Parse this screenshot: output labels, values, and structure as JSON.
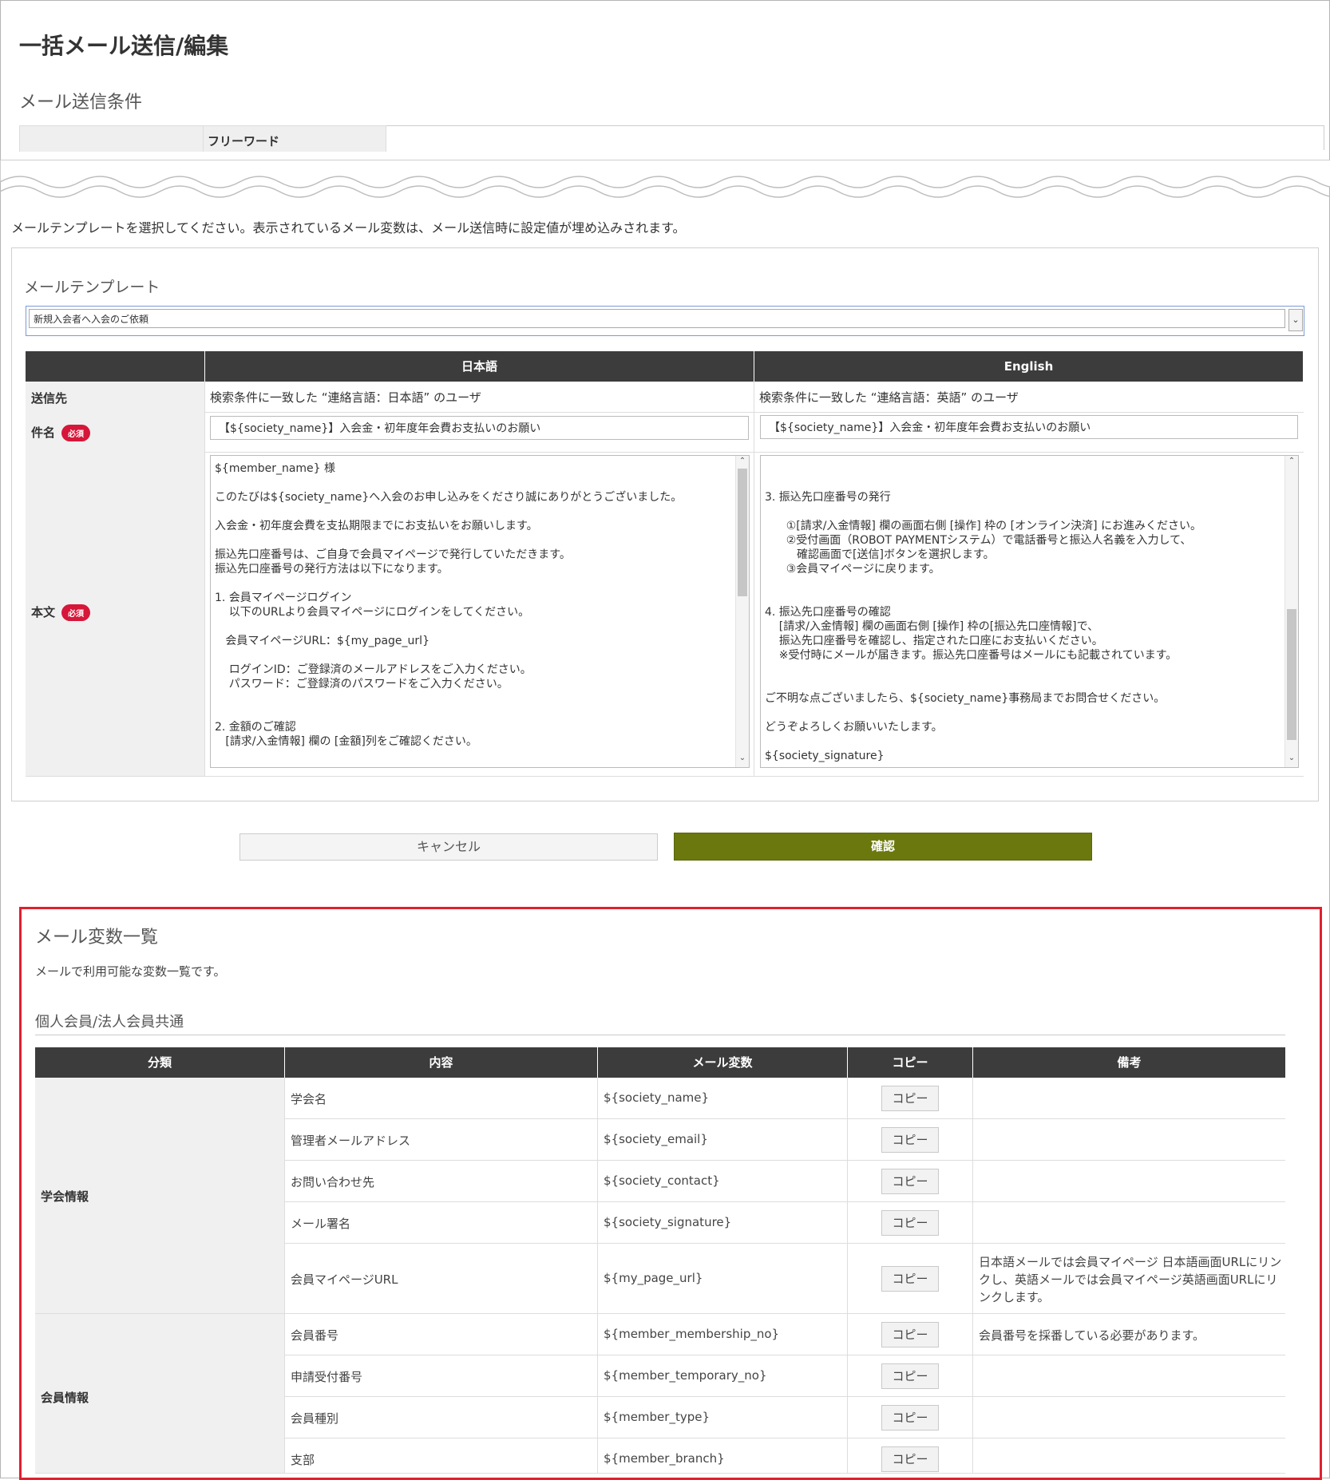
{
  "page_title": "一括メール送信/編集",
  "conditions": {
    "heading": "メール送信条件",
    "freeword_label": "フリーワード"
  },
  "intro_text": "メールテンプレートを選択してください。表示されているメール変数は、メール送信時に設定値が埋め込みされます。",
  "template": {
    "label": "メールテンプレート",
    "selected": "新規入会者へ入会のご依頼"
  },
  "mail_table": {
    "col_ja": "日本語",
    "col_en": "English",
    "row_to": "送信先",
    "row_subject": "件名",
    "row_body": "本文",
    "required": "必須",
    "to_ja": "検索条件に一致した “連絡言語：日本語” のユーザ",
    "to_en": "検索条件に一致した “連絡言語：英語” のユーザ",
    "subject_ja": "【${society_name}】入会金・初年度年会費お支払いのお願い",
    "subject_en": "【${society_name}】入会金・初年度年会費お支払いのお願い",
    "body_ja": [
      "${member_name} 様",
      "",
      "このたびは${society_name}へ入会のお申し込みをくださり誠にありがとうございました。",
      "",
      "入会金・初年度会費を支払期限までにお支払いをお願いします。",
      "",
      "振込先口座番号は、ご自身で会員マイページで発行していただきます。",
      "振込先口座番号の発行方法は以下になります。",
      "",
      "1. 会員マイページログイン",
      "    以下のURLより会員マイページにログインをしてください。",
      "",
      "   会員マイページURL：${my_page_url}",
      "",
      "    ログインID：ご登録済のメールアドレスをご入力ください。",
      "    パスワード：ご登録済のパスワードをご入力ください。",
      "",
      "",
      "2. 金額のご確認",
      "   [請求/入金情報] 欄の [金額]列をご確認ください。"
    ],
    "body_en": [
      "",
      "",
      "3. 振込先口座番号の発行",
      "",
      "      ①[請求/入金情報] 欄の画面右側 [操作] 枠の [オンライン決済] にお進みください。",
      "      ②受付画面（ROBOT PAYMENTシステム）で電話番号と振込人名義を入力して、",
      "         確認画面で[送信]ボタンを選択します。",
      "      ③会員マイページに戻ります。",
      "",
      "",
      "4. 振込先口座番号の確認",
      "    [請求/入金情報] 欄の画面右側 [操作] 枠の[振込先口座情報]で、",
      "    振込先口座番号を確認し、指定された口座にお支払いください。",
      "    ※受付時にメールが届きます。振込先口座番号はメールにも記載されています。",
      "",
      "",
      "ご不明な点ございましたら、${society_name}事務局までお問合せください。",
      "",
      "どうぞよろしくお願いいたします。",
      "",
      "${society_signature}"
    ]
  },
  "buttons": {
    "cancel": "キャンセル",
    "confirm": "確認"
  },
  "variables": {
    "title": "メール変数一覧",
    "description": "メールで利用可能な変数一覧です。",
    "subheading": "個人会員/法人会員共通",
    "headers": [
      "分類",
      "内容",
      "メール変数",
      "コピー",
      "備考"
    ],
    "copy_label": "コピー",
    "groups": [
      {
        "category": "学会情報",
        "rows": [
          {
            "content": "学会名",
            "var": "${society_name}",
            "note": ""
          },
          {
            "content": "管理者メールアドレス",
            "var": "${society_email}",
            "note": ""
          },
          {
            "content": "お問い合わせ先",
            "var": "${society_contact}",
            "note": ""
          },
          {
            "content": "メール署名",
            "var": "${society_signature}",
            "note": ""
          },
          {
            "content": "会員マイページURL",
            "var": "${my_page_url}",
            "note": [
              "日本語メールでは会員マイページ 日本語画面URLにリン",
              "クし、英語メールでは会員マイページ英語画面URLにリ",
              "ンクします。"
            ]
          }
        ]
      },
      {
        "category": "会員情報",
        "rows": [
          {
            "content": "会員番号",
            "var": "${member_membership_no}",
            "note": "会員番号を採番している必要があります。"
          },
          {
            "content": "申請受付番号",
            "var": "${member_temporary_no}",
            "note": ""
          },
          {
            "content": "会員種別",
            "var": "${member_type}",
            "note": ""
          },
          {
            "content": "支部",
            "var": "${member_branch}",
            "note": ""
          }
        ]
      }
    ]
  }
}
